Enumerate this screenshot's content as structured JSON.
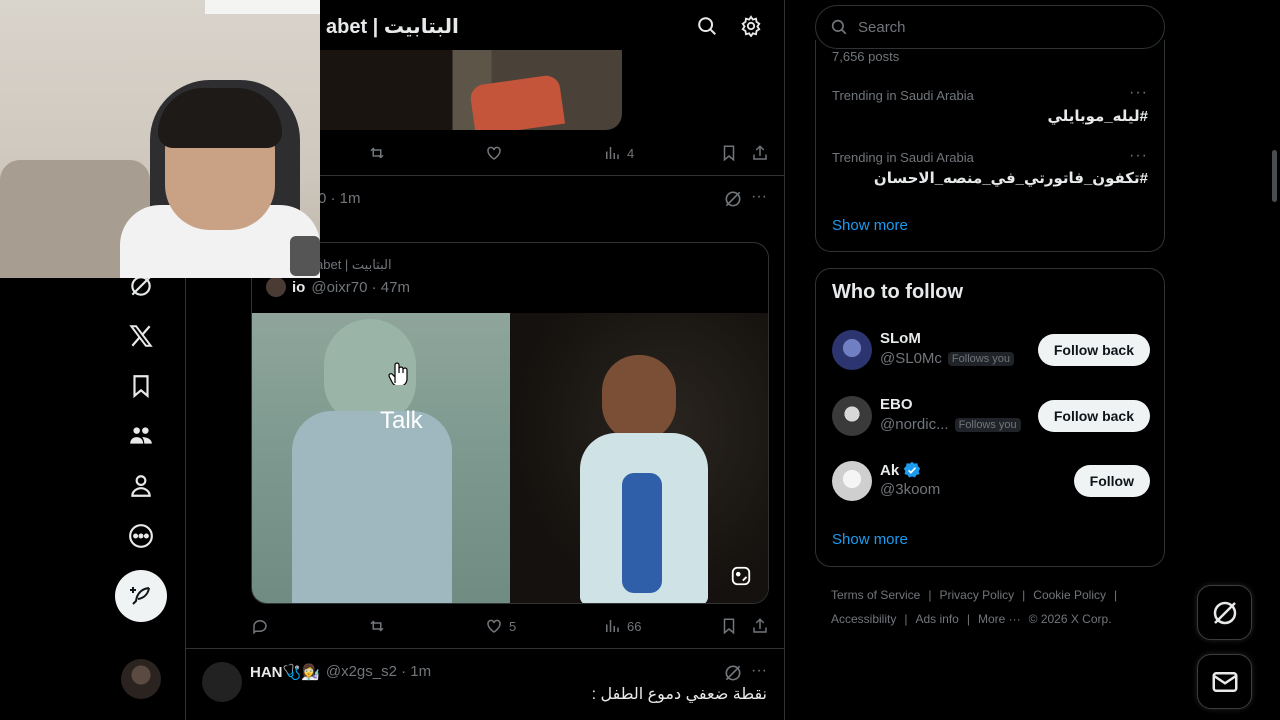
{
  "header": {
    "title": "البتابيت | Batabet",
    "title_visible": "abet | البتابيت"
  },
  "previous_post": {
    "views": "4"
  },
  "quote_post": {
    "meta": "0 · 1m",
    "quoted_source": "abet | البتابيت",
    "quoted_name": "io",
    "quoted_handle": "@oixr70 · 47m",
    "image_text": "Talk",
    "likes": "5",
    "views": "66"
  },
  "next_post": {
    "name": "HAN🩺👩‍🔬",
    "handle": "@x2gs_s2 · 1m",
    "text": "نقطة ضعفي دموع الطفل :"
  },
  "search": {
    "placeholder": "Search"
  },
  "trends": {
    "posts_count": "7,656 posts",
    "items": [
      {
        "context": "Trending in Saudi Arabia",
        "tag": "#ليله_موبايلي"
      },
      {
        "context": "Trending in Saudi Arabia",
        "tag": "#تكفون_فاتورتي_في_منصه_الاحسان"
      }
    ],
    "show_more": "Show more"
  },
  "who_to_follow": {
    "title": "Who to follow",
    "users": [
      {
        "name": "SLoM",
        "handle": "@SL0Mc",
        "badge": "Follows you",
        "button": "Follow back",
        "verified": false
      },
      {
        "name": "EBO",
        "handle": "@nordic...",
        "badge": "Follows you",
        "button": "Follow back",
        "verified": false
      },
      {
        "name": "Ak",
        "handle": "@3koom",
        "badge": "",
        "button": "Follow",
        "verified": true
      }
    ],
    "show_more": "Show more"
  },
  "footer": {
    "line1": [
      "Terms of Service",
      "Privacy Policy",
      "Cookie Policy"
    ],
    "line2": [
      "Accessibility",
      "Ads info",
      "More ···",
      "© 2026 X Corp."
    ]
  },
  "colors": {
    "accent": "#1d9bf0",
    "verified": "#1d9bf0",
    "border": "#2f3336",
    "muted": "#71767b"
  }
}
